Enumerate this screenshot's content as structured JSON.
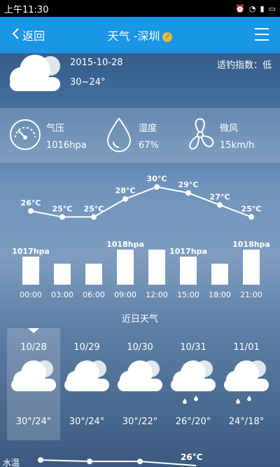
{
  "status": {
    "time": "上午11:30"
  },
  "header": {
    "back_label": "返回",
    "title": "天气 -深圳",
    "badge": "v"
  },
  "today": {
    "date": "2015-10-28",
    "range": "30~24°",
    "fishing_index": "适钓指数：低"
  },
  "metrics": {
    "pressure": {
      "label": "气压",
      "value": "1016hpa"
    },
    "humidity": {
      "label": "湿度",
      "value": "67%"
    },
    "wind": {
      "label": "微风",
      "value": "15km/h"
    }
  },
  "chart_data": {
    "type": "line",
    "x": [
      "00:00",
      "03:00",
      "06:00",
      "09:00",
      "12:00",
      "15:00",
      "18:00",
      "21:00"
    ],
    "temperature_labels": [
      "26°C",
      "25°C",
      "25°C",
      "28°C",
      "30°C",
      "29°C",
      "27°C",
      "25°C"
    ],
    "temperature": [
      26,
      25,
      25,
      28,
      30,
      29,
      27,
      25
    ],
    "pressure": [
      1017,
      1016,
      1016,
      1018,
      1018,
      1017,
      1016,
      1018
    ],
    "pressure_labels": [
      "1017hpa",
      "",
      "",
      "1018hpa",
      "",
      "1017hpa",
      "",
      "1018hpa"
    ]
  },
  "recent_label": "近日天气",
  "forecast": [
    {
      "date": "10/28",
      "temp": "30°/24°",
      "rain": false
    },
    {
      "date": "10/29",
      "temp": "30°/24°",
      "rain": false
    },
    {
      "date": "10/30",
      "temp": "30°/22°",
      "rain": false
    },
    {
      "date": "10/31",
      "temp": "26°/20°",
      "rain": true
    },
    {
      "date": "11/01",
      "temp": "24°/18°",
      "rain": true
    }
  ],
  "bottom": {
    "left_label": "水温",
    "value": "26°C"
  },
  "colors": {
    "titlebar": "#1996e6",
    "badge": "#f4b63a"
  }
}
